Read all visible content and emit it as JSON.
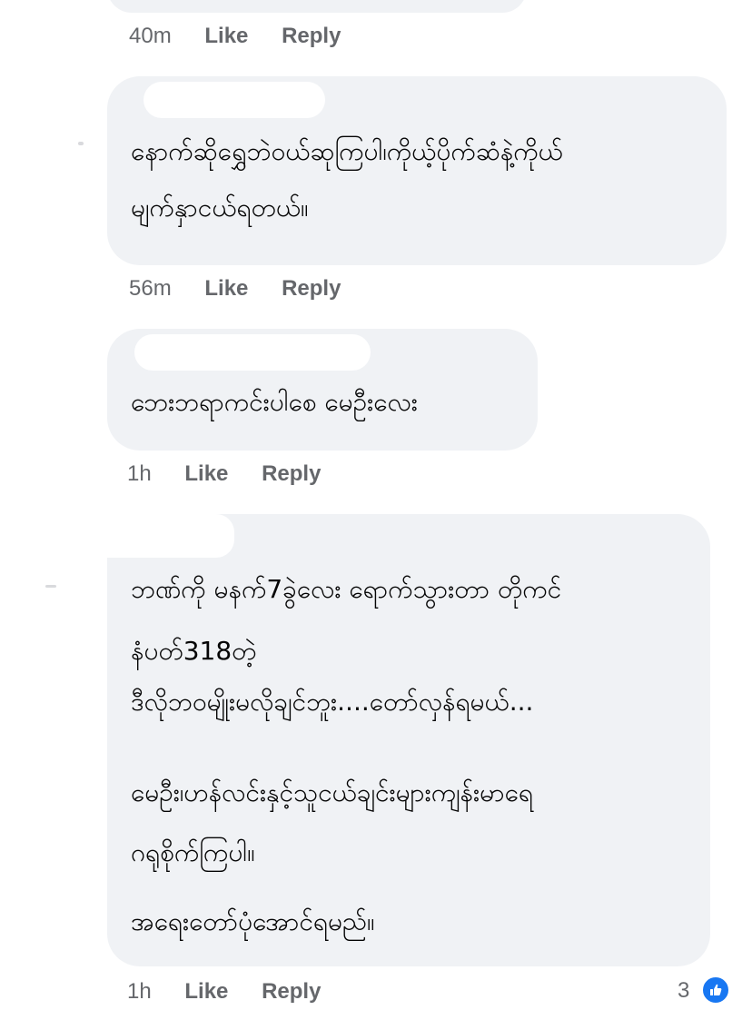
{
  "comments": [
    {
      "lines": [],
      "time": "40m",
      "like": "Like",
      "reply": "Reply"
    },
    {
      "lines": [
        "နောက်ဆိုရွှေဘဲဝယ်ဆုကြပါ၊ကိုယ့်ပိုက်ဆံနဲ့ကိုယ်",
        "မျက်နှာငယ်ရတယ်။"
      ],
      "time": "56m",
      "like": "Like",
      "reply": "Reply"
    },
    {
      "lines": [
        "ဘေးဘရာကင်းပါစေ မေဦးလေး"
      ],
      "time": "1h",
      "like": "Like",
      "reply": "Reply"
    },
    {
      "lines": [
        "ဘဏ်ကို မနက်7ခွဲလေး ရောက်သွားတာ တိုကင်",
        "နံပတ်318တဲ့",
        "ဒီလိုဘ၀မျိုးမလိုချင်ဘူး....တော်လှန်ရမယ်...",
        "မေဦး၊ဟန်လင်းနှင့်သူငယ်ချင်းများကျန်းမာရေ",
        "ဂရုစိုက်ကြပါ။",
        "အရေးတော်ပုံအောင်ရမည်။"
      ],
      "time": "1h",
      "like": "Like",
      "reply": "Reply",
      "reaction_count": "3",
      "reaction_icon": "thumbs-up-icon",
      "reaction_color": "#1877f2"
    }
  ]
}
